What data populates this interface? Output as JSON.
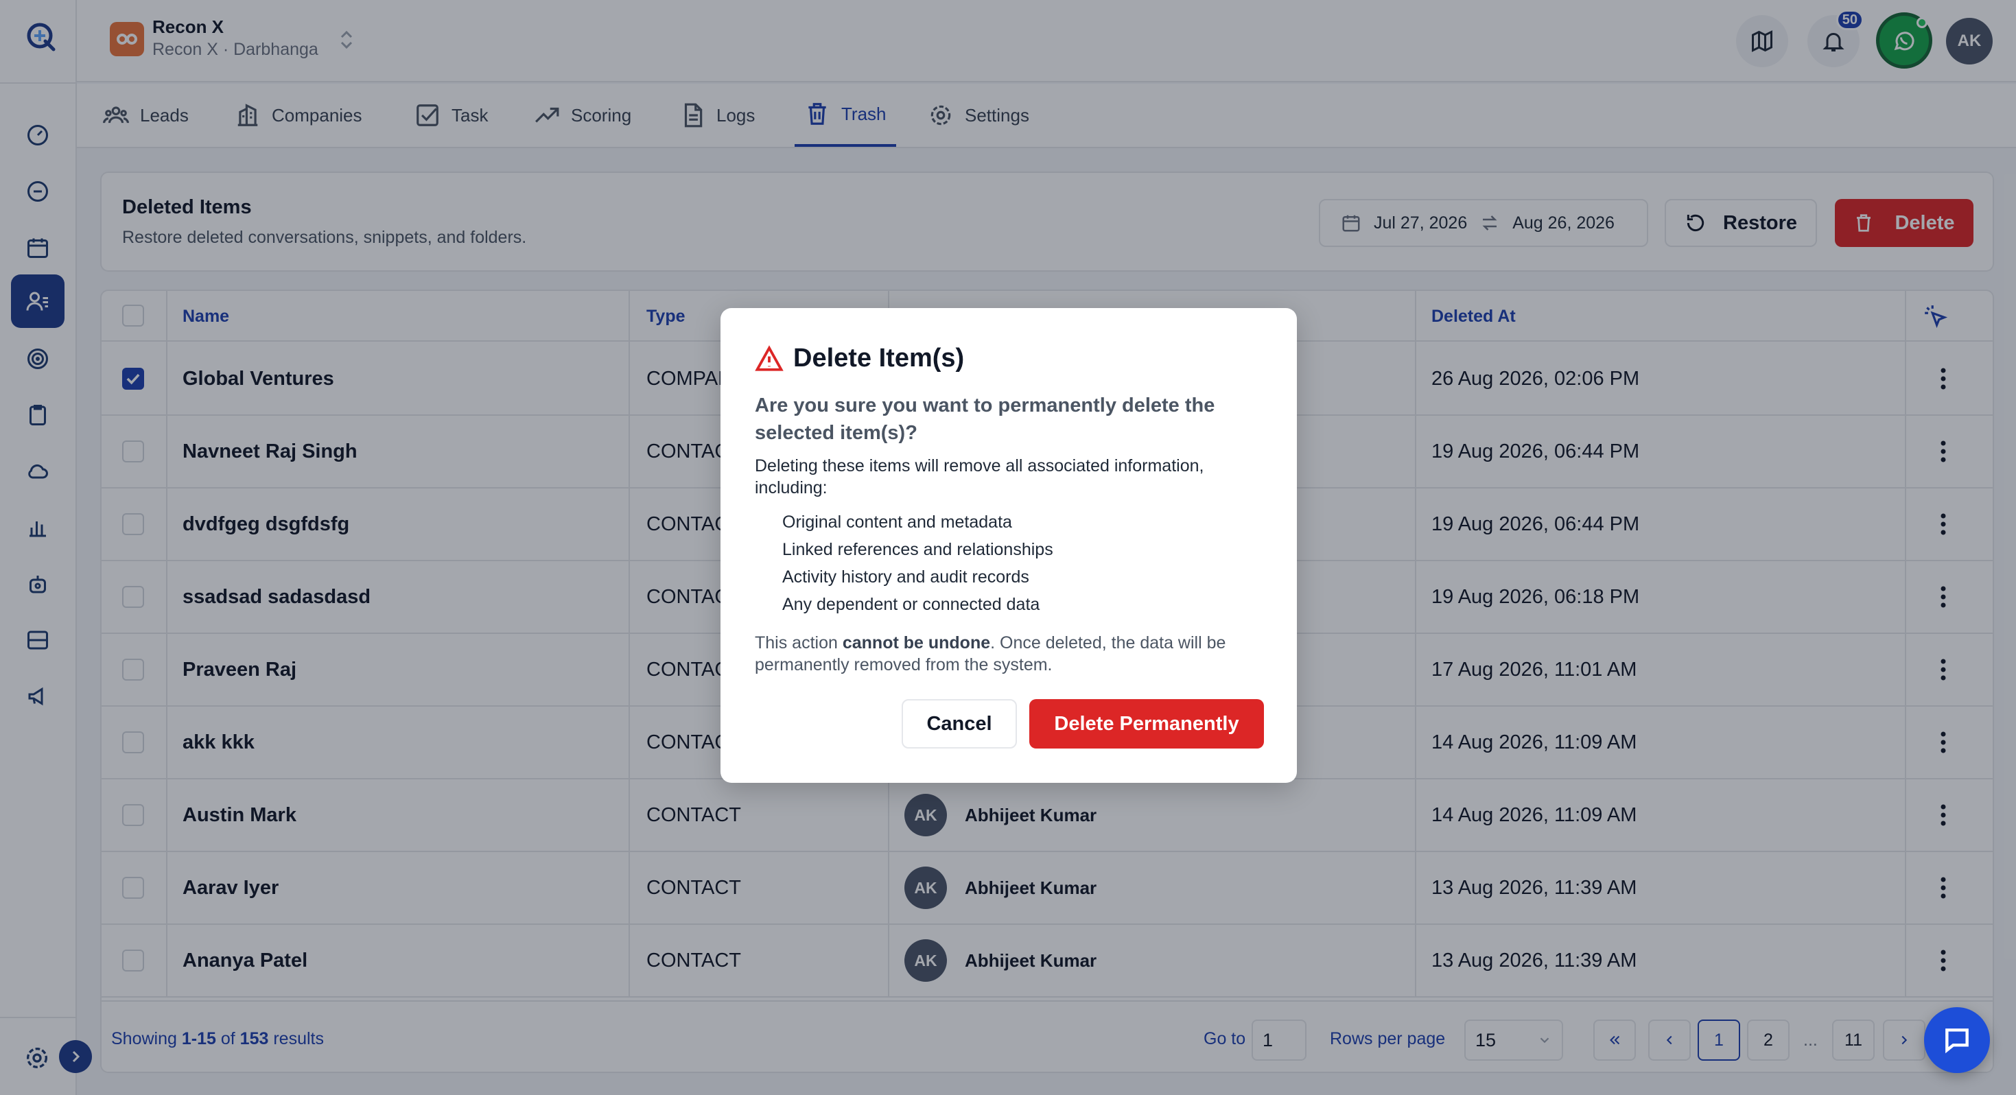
{
  "workspace": {
    "name": "Recon X",
    "subtitle": "Recon X · Darbhanga"
  },
  "header": {
    "notifications_count": "50",
    "avatar_initials": "AK"
  },
  "tabs": [
    {
      "label": "Leads",
      "icon": "users-icon"
    },
    {
      "label": "Companies",
      "icon": "building-icon"
    },
    {
      "label": "Task",
      "icon": "checkbox-icon"
    },
    {
      "label": "Scoring",
      "icon": "trend-icon"
    },
    {
      "label": "Logs",
      "icon": "document-icon"
    },
    {
      "label": "Trash",
      "icon": "trash-icon",
      "active": true
    },
    {
      "label": "Settings",
      "icon": "gear-icon"
    }
  ],
  "page": {
    "title": "Deleted Items",
    "subtitle": "Restore deleted conversations, snippets, and folders.",
    "date_from": "Jul 27, 2026",
    "date_to": "Aug 26, 2026",
    "restore_label": "Restore",
    "delete_label": "Delete"
  },
  "table": {
    "columns": {
      "name": "Name",
      "type": "Type",
      "deleted_at": "Deleted At"
    },
    "rows": [
      {
        "name": "Global Ventures",
        "type": "COMPANY",
        "owner_initials": "",
        "owner": "",
        "deleted_at": "26 Aug 2026, 02:06 PM",
        "checked": true
      },
      {
        "name": "Navneet Raj Singh",
        "type": "CONTACT",
        "owner_initials": "",
        "owner": "",
        "deleted_at": "19 Aug 2026, 06:44 PM",
        "checked": false
      },
      {
        "name": "dvdfgeg dsgfdsfg",
        "type": "CONTACT",
        "owner_initials": "",
        "owner": "",
        "deleted_at": "19 Aug 2026, 06:44 PM",
        "checked": false
      },
      {
        "name": "ssadsad sadasdasd",
        "type": "CONTACT",
        "owner_initials": "",
        "owner": "",
        "deleted_at": "19 Aug 2026, 06:18 PM",
        "checked": false
      },
      {
        "name": "Praveen Raj",
        "type": "CONTACT",
        "owner_initials": "",
        "owner": "",
        "deleted_at": "17 Aug 2026, 11:01 AM",
        "checked": false
      },
      {
        "name": "akk kkk",
        "type": "CONTACT",
        "owner_initials": "",
        "owner": "",
        "deleted_at": "14 Aug 2026, 11:09 AM",
        "checked": false
      },
      {
        "name": "Austin Mark",
        "type": "CONTACT",
        "owner_initials": "AK",
        "owner": "Abhijeet Kumar",
        "deleted_at": "14 Aug 2026, 11:09 AM",
        "checked": false
      },
      {
        "name": "Aarav Iyer",
        "type": "CONTACT",
        "owner_initials": "AK",
        "owner": "Abhijeet Kumar",
        "deleted_at": "13 Aug 2026, 11:39 AM",
        "checked": false
      },
      {
        "name": "Ananya Patel",
        "type": "CONTACT",
        "owner_initials": "AK",
        "owner": "Abhijeet Kumar",
        "deleted_at": "13 Aug 2026, 11:39 AM",
        "checked": false
      }
    ]
  },
  "footer": {
    "showing_prefix": "Showing",
    "range": "1-15",
    "of_word": "of",
    "total": "153",
    "results_word": "results",
    "goto_label": "Go to",
    "goto_value": "1",
    "rows_label": "Rows per page",
    "rows_value": "15",
    "pages": [
      "1",
      "2",
      "11"
    ],
    "ellipsis": "..."
  },
  "modal": {
    "title": "Delete Item(s)",
    "question": "Are you sure you want to permanently delete the selected item(s)?",
    "description": "Deleting these items will remove all associated information, including:",
    "items": [
      "Original content and metadata",
      "Linked references and relationships",
      "Activity history and audit records",
      "Any dependent or connected data"
    ],
    "note_prefix": "This action",
    "note_bold": "cannot be undone",
    "note_suffix": ". Once deleted, the data will be permanently removed from the system.",
    "cancel_label": "Cancel",
    "confirm_label": "Delete Permanently"
  },
  "colors": {
    "accent": "#1e40af",
    "danger": "#dc2626",
    "whatsapp": "#16a34a"
  }
}
